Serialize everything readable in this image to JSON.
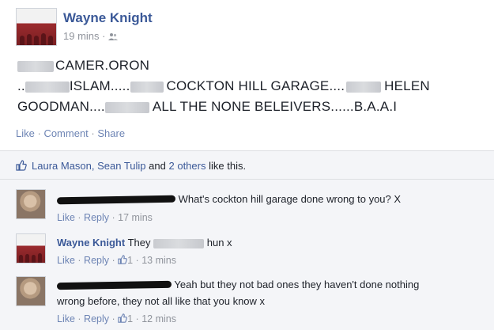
{
  "post": {
    "author": "Wayne Knight",
    "time": "19 mins",
    "audience_icon": "friends-icon",
    "line1": "CAMER.ORON",
    "line2a": "..",
    "line2b": "ISLAM.....",
    "line2c": "COCKTON HILL GARAGE....",
    "line2d": "HELEN",
    "line3a": "GOODMAN....",
    "line3b": "ALL THE NONE BELEIVERS......B.A.A.I",
    "actions": [
      "Like",
      "Comment",
      "Share"
    ]
  },
  "likes": {
    "icon": "like-thumb-icon",
    "names": "Laura Mason, Sean Tulip",
    "and": "and",
    "others": "2 others",
    "suffix": "like this."
  },
  "comments": [
    {
      "text": "What's cockton hill garage done wrong to you? X",
      "like": "Like",
      "reply": "Reply",
      "time": "17 mins"
    },
    {
      "author": "Wayne Knight",
      "text_a": "They",
      "text_b": "hun x",
      "like": "Like",
      "reply": "Reply",
      "count": "1",
      "time": "13 mins"
    },
    {
      "text_a": "Yeah but they not bad ones they haven't done nothing",
      "text_b": "wrong before, they not all like that you know x",
      "like": "Like",
      "reply": "Reply",
      "count": "1",
      "time": "12 mins"
    }
  ],
  "colors": {
    "link": "#3b5998",
    "meta": "#90949c",
    "background": "#f4f5f8"
  }
}
